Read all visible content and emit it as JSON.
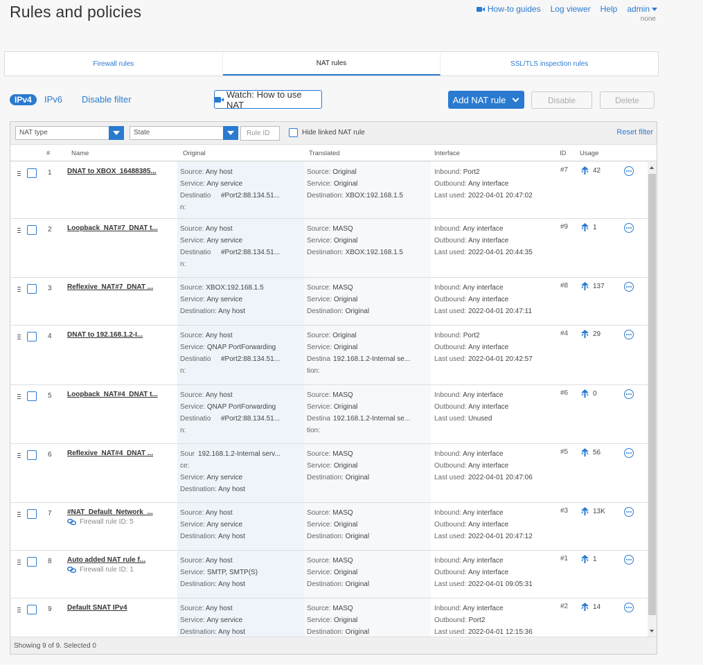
{
  "page": {
    "title": "Rules and policies"
  },
  "top": {
    "howto": "How-to guides",
    "logviewer": "Log viewer",
    "help": "Help",
    "user": "admin",
    "sub": "none"
  },
  "tabs": [
    {
      "label": "Firewall rules"
    },
    {
      "label": "NAT rules"
    },
    {
      "label": "SSL/TLS inspection rules"
    }
  ],
  "toolbar": {
    "ipv4": "IPv4",
    "ipv6": "IPv6",
    "disable_filter": "Disable filter",
    "watch": "Watch: How to use NAT",
    "add": "Add NAT rule",
    "disable": "Disable",
    "delete": "Delete"
  },
  "filters": {
    "nat_type": "NAT type",
    "state": "State",
    "rule_id": "Rule ID",
    "hide_linked": "Hide linked NAT rule",
    "reset": "Reset filter"
  },
  "columns": {
    "num": "#",
    "name": "Name",
    "original": "Original",
    "translated": "Translated",
    "interface": "Interface",
    "id": "ID",
    "usage": "Usage"
  },
  "labels": {
    "source": "Source:",
    "service": "Service:",
    "destination": "Destination:",
    "destinatio": "Destinatio",
    "n": "n:",
    "destina": "Destina",
    "tion": "tion:",
    "sour": "Sour",
    "ce": "ce:",
    "inbound": "Inbound:",
    "outbound": "Outbound:",
    "last_used": "Last used:"
  },
  "rows": [
    {
      "num": "1",
      "name": "DNAT to XBOX_16488385...",
      "o_src": "Any host",
      "o_svc": "Any service",
      "o_dst": "#Port2:88.134.51...",
      "t_src": "Original",
      "t_svc": "Original",
      "t_dst": "XBOX:192.168.1.5",
      "in": "Port2",
      "out": "Any interface",
      "last": "2022-04-01 20:47:02",
      "id": "#7",
      "usage": "42"
    },
    {
      "num": "2",
      "name": "Loopback_NAT#7_DNAT t...",
      "o_src": "Any host",
      "o_svc": "Any service",
      "o_dst": "#Port2:88.134.51...",
      "t_src": "MASQ",
      "t_svc": "Original",
      "t_dst": "XBOX:192.168.1.5",
      "in": "Any interface",
      "out": "Any interface",
      "last": "2022-04-01 20:44:35",
      "id": "#9",
      "usage": "1"
    },
    {
      "num": "3",
      "name": "Reflexive_NAT#7_DNAT ...",
      "o_src": "XBOX:192.168.1.5",
      "o_svc": "Any service",
      "o_dst": "Any host",
      "t_src": "MASQ",
      "t_svc": "Original",
      "t_dst": "Original",
      "in": "Any interface",
      "out": "Any interface",
      "last": "2022-04-01 20:47:11",
      "id": "#8",
      "usage": "137"
    },
    {
      "num": "4",
      "name": "DNAT to 192.168.1.2-I...",
      "o_src": "Any host",
      "o_svc": "QNAP PortForwarding",
      "o_dst": "#Port2:88.134.51...",
      "t_src": "Original",
      "t_svc": "Original",
      "t_dst": "192.168.1.2-Internal se...",
      "in": "Port2",
      "out": "Any interface",
      "last": "2022-04-01 20:42:57",
      "id": "#4",
      "usage": "29"
    },
    {
      "num": "5",
      "name": "Loopback_NAT#4_DNAT t...",
      "o_src": "Any host",
      "o_svc": "QNAP PortForwarding",
      "o_dst": "#Port2:88.134.51...",
      "t_src": "MASQ",
      "t_svc": "Original",
      "t_dst": "192.168.1.2-Internal se...",
      "in": "Any interface",
      "out": "Any interface",
      "last": "Unused",
      "id": "#6",
      "usage": "0"
    },
    {
      "num": "6",
      "name": "Reflexive_NAT#4_DNAT ...",
      "o_src": "192.168.1.2-Internal serv...",
      "o_svc": "Any service",
      "o_dst": "Any host",
      "t_src": "MASQ",
      "t_svc": "Original",
      "t_dst": "Original",
      "in": "Any interface",
      "out": "Any interface",
      "last": "2022-04-01 20:47:06",
      "id": "#5",
      "usage": "56"
    },
    {
      "num": "7",
      "name": "#NAT_Default_Network_...",
      "fw": "Firewall rule ID: 5",
      "o_src": "Any host",
      "o_svc": "Any service",
      "o_dst": "Any host",
      "t_src": "MASQ",
      "t_svc": "Original",
      "t_dst": "Original",
      "in": "Any interface",
      "out": "Any interface",
      "last": "2022-04-01 20:47:12",
      "id": "#3",
      "usage": "13K"
    },
    {
      "num": "8",
      "name": "Auto added NAT rule f...",
      "fw": "Firewall rule ID: 1",
      "o_src": "Any host",
      "o_svc": "SMTP, SMTP(S)",
      "o_dst": "Any host",
      "t_src": "MASQ",
      "t_svc": "Original",
      "t_dst": "Original",
      "in": "Any interface",
      "out": "Any interface",
      "last": "2022-04-01 09:05:31",
      "id": "#1",
      "usage": "1"
    },
    {
      "num": "9",
      "name": "Default SNAT IPv4",
      "o_src": "Any host",
      "o_svc": "Any service",
      "o_dst": "Any host",
      "t_src": "MASQ",
      "t_svc": "Original",
      "t_dst": "Original",
      "in": "Any interface",
      "out": "Port2",
      "last": "2022-04-01 12:15:36",
      "id": "#2",
      "usage": "14"
    }
  ],
  "footer": {
    "status": "Showing 9 of 9. Selected 0"
  },
  "colors": {
    "accent": "#2a7ad0"
  }
}
